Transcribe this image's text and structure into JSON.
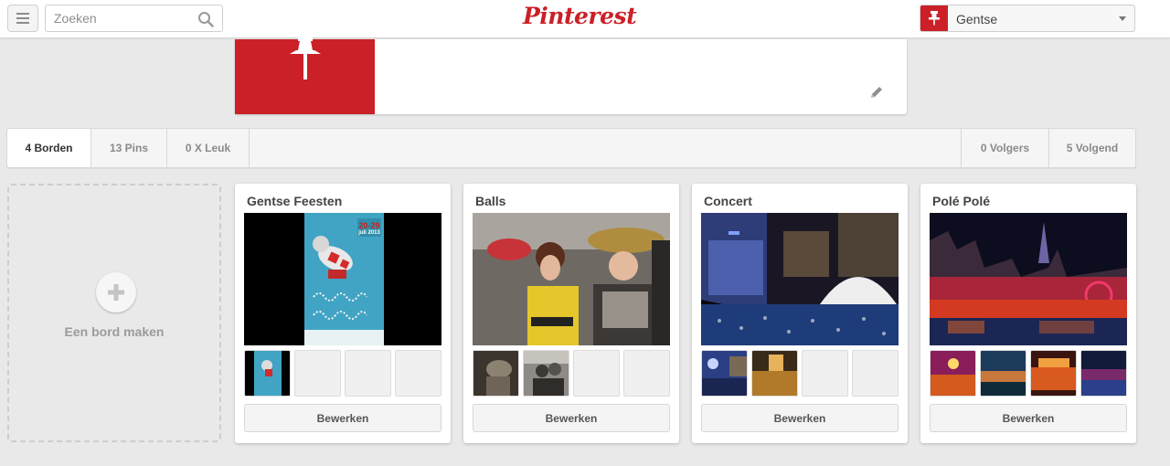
{
  "header": {
    "search_placeholder": "Zoeken",
    "logo": "Pinterest",
    "board_selector": "Gentse"
  },
  "stats": {
    "boards": "4 Borden",
    "pins": "13 Pins",
    "likes": "0 X Leuk",
    "followers": "0 Volgers",
    "following": "5 Volgend"
  },
  "create_board": {
    "label": "Een bord maken"
  },
  "boards": [
    {
      "title": "Gentse Feesten",
      "edit_label": "Bewerken",
      "cover_text_line1": "20-29",
      "cover_text_line2": "juli 2013"
    },
    {
      "title": "Balls",
      "edit_label": "Bewerken"
    },
    {
      "title": "Concert",
      "edit_label": "Bewerken"
    },
    {
      "title": "Polé Polé",
      "edit_label": "Bewerken"
    }
  ],
  "colors": {
    "brand_red": "#cb2027",
    "background": "#e9e9e9"
  }
}
